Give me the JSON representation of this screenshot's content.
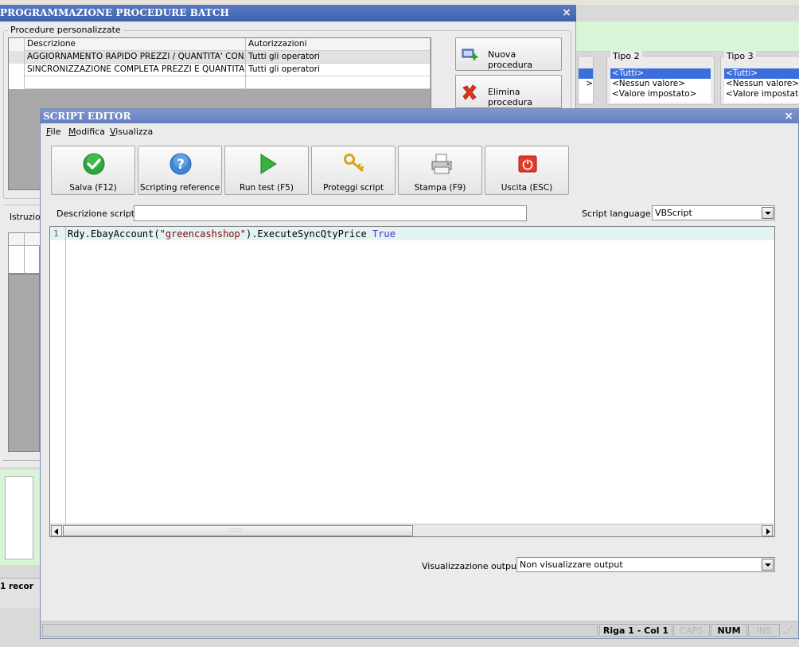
{
  "background_window": {
    "title": "PROGRAMMAZIONE PROCEDURE BATCH",
    "close_glyph": "×",
    "group_label": "Procedure personalizzate",
    "table": {
      "columns": [
        "Descrizione",
        "Autorizzazioni"
      ],
      "rows": [
        [
          "AGGIORNAMENTO RAPIDO PREZZI / QUANTITA' CON...",
          "Tutti gli operatori"
        ],
        [
          "SINCRONIZZAZIONE COMPLETA PREZZI E QUANTITA...",
          "Tutti gli operatori"
        ]
      ]
    },
    "buttons": {
      "new": "Nuova procedura",
      "delete": "Elimina procedura"
    },
    "istruzioni_label": "Istruzio",
    "records_label": "1 recor",
    "tipo2": {
      "label": "Tipo 2",
      "items": [
        "<Tutti>",
        "<Nessun valore>",
        "<Valore impostato>"
      ]
    },
    "tipo3": {
      "label": "Tipo 3",
      "items": [
        "<Tutti>",
        "<Nessun valore>",
        "<Valore impostato>"
      ]
    }
  },
  "editor": {
    "title": "SCRIPT EDITOR",
    "close_glyph": "×",
    "menu": [
      {
        "accel": "F",
        "rest": "ile"
      },
      {
        "accel": "M",
        "rest": "odifica"
      },
      {
        "accel": "V",
        "rest": "isualizza"
      }
    ],
    "toolbar": {
      "save": "Salva (F12)",
      "reference": "Scripting reference",
      "run": "Run test (F5)",
      "protect": "Proteggi script",
      "print": "Stampa (F9)",
      "exit": "Uscita (ESC)"
    },
    "description_label": "Descrizione script :",
    "description_value": "",
    "language_label": "Script language :",
    "language_value": "VBScript",
    "code": {
      "line_number": "1",
      "part1": "Rdy.EbayAccount(",
      "string": "\"greencashshop\"",
      "part2": ").ExecuteSyncQtyPrice ",
      "keyword": "True"
    },
    "scroll_grip": ":::::::",
    "output_label": "Visualizzazione output :",
    "output_value": "Non visualizzare output",
    "status": {
      "position": "Riga 1 - Col 1",
      "caps": "CAPS",
      "num": "NUM",
      "ins": "INS"
    }
  },
  "colors": {
    "title_bar": "#3e60ad",
    "editor_title_bar": "#6480c1",
    "selection": "#3c6edb",
    "green_panel": "#d8f5d8",
    "code_highlight": "#e3f3f3"
  }
}
